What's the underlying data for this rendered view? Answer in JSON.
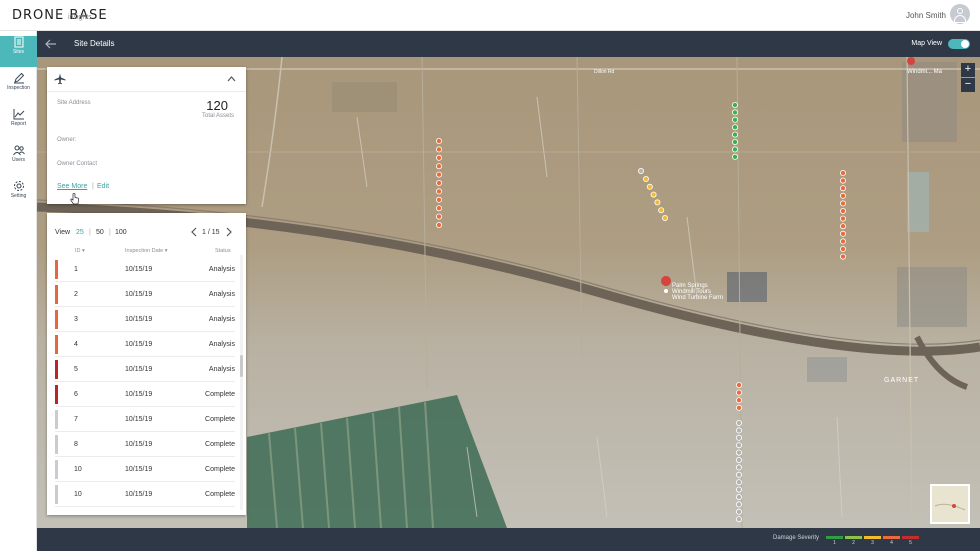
{
  "app": {
    "logo": "DRONE BASE",
    "logo_sub": "insights",
    "user_name": "John Smith"
  },
  "sidebar": {
    "items": [
      {
        "label": "Sites",
        "icon": "sites-icon",
        "active": true
      },
      {
        "label": "Inspection",
        "icon": "inspection-icon"
      },
      {
        "label": "Report",
        "icon": "report-icon"
      },
      {
        "label": "Users",
        "icon": "users-icon"
      },
      {
        "label": "Setting",
        "icon": "setting-icon"
      }
    ]
  },
  "header": {
    "title": "Site Details",
    "map_view_label": "Map View",
    "map_view_on": true
  },
  "site_card": {
    "site_address_label": "Site Address",
    "total_assets_value": "120",
    "total_assets_label": "Total Assets",
    "owner_label": "Owner:",
    "owner_contact_label": "Owner Contact",
    "see_more": "See More",
    "separator": "|",
    "edit": "Edit"
  },
  "table": {
    "view_label": "View",
    "view_options": [
      "25",
      "50",
      "100"
    ],
    "selected_view": "25",
    "pagination": "1 / 15",
    "columns": {
      "id": "ID ▾",
      "date": "Inspection Date ▾",
      "status": "Status"
    },
    "rows": [
      {
        "id": "1",
        "date": "10/15/19",
        "status": "Analysis",
        "color": "#e2683f"
      },
      {
        "id": "2",
        "date": "10/15/19",
        "status": "Analysis",
        "color": "#e2683f"
      },
      {
        "id": "3",
        "date": "10/15/19",
        "status": "Analysis",
        "color": "#e2683f"
      },
      {
        "id": "4",
        "date": "10/15/19",
        "status": "Analysis",
        "color": "#e2683f"
      },
      {
        "id": "5",
        "date": "10/15/19",
        "status": "Analysis",
        "color": "#b8262a"
      },
      {
        "id": "6",
        "date": "10/15/19",
        "status": "Complete",
        "color": "#b8262a"
      },
      {
        "id": "7",
        "date": "10/15/19",
        "status": "Complete",
        "color": "#c9ccd1"
      },
      {
        "id": "8",
        "date": "10/15/19",
        "status": "Complete",
        "color": "#c9ccd1"
      },
      {
        "id": "10",
        "date": "10/15/19",
        "status": "Complete",
        "color": "#c9ccd1"
      },
      {
        "id": "10",
        "date": "10/15/19",
        "status": "Complete",
        "color": "#c9ccd1"
      }
    ]
  },
  "map": {
    "labels": {
      "marker": "Palm Springs\nWindmill Tours\nWind Turbine Farm",
      "top_right": "Windmi... Ma",
      "town": "GARNET",
      "road": "Dillon Rd"
    },
    "zoom_in": "+",
    "zoom_out": "−",
    "turbine_colors": {
      "gray": "#b3b3b3",
      "yellow": "#f3bc2a",
      "green": "#3bb24b",
      "orange": "#ec6a3c",
      "red": "#c52d2d"
    }
  },
  "severity": {
    "label": "Damage Severity",
    "levels": [
      {
        "n": "1",
        "color": "#2ea043"
      },
      {
        "n": "2",
        "color": "#8bc34a"
      },
      {
        "n": "3",
        "color": "#f3bc2a"
      },
      {
        "n": "4",
        "color": "#ec6a3c"
      },
      {
        "n": "5",
        "color": "#c52d2d"
      }
    ]
  }
}
